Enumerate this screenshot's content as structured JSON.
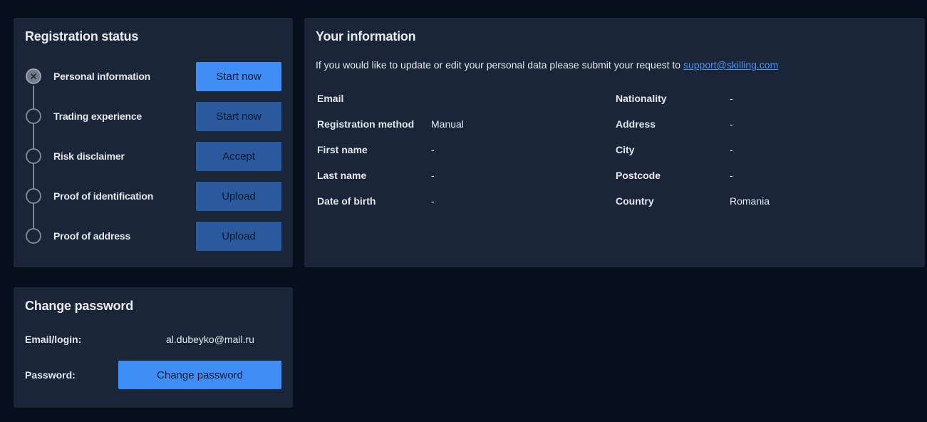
{
  "colors": {
    "page_bg": "#060f1c",
    "card_bg": "#1a2538",
    "primary_button": "#3f8ef5",
    "secondary_button": "#2a5a9d",
    "link": "#4a93f0"
  },
  "registration": {
    "title": "Registration status",
    "steps": [
      {
        "label": "Personal information",
        "button": "Start now",
        "icon": "close-icon",
        "status": "active"
      },
      {
        "label": "Trading experience",
        "button": "Start now"
      },
      {
        "label": "Risk disclaimer",
        "button": "Accept"
      },
      {
        "label": "Proof of identification",
        "button": "Upload"
      },
      {
        "label": "Proof of address",
        "button": "Upload"
      }
    ]
  },
  "password": {
    "title": "Change password",
    "email_label": "Email/login:",
    "email_value": "al.dubeyko@mail.ru",
    "password_label": "Password:",
    "button": "Change password"
  },
  "info": {
    "title": "Your information",
    "note": "If you would like to update or edit your personal data please submit your request to",
    "support_email": "support@skilling.com",
    "left": [
      {
        "label": "Email",
        "value": ""
      },
      {
        "label": "Registration method",
        "value": "Manual"
      },
      {
        "label": "First name",
        "value": "-"
      },
      {
        "label": "Last name",
        "value": "-"
      },
      {
        "label": "Date of birth",
        "value": "-"
      }
    ],
    "right": [
      {
        "label": "Nationality",
        "value": "-"
      },
      {
        "label": "Address",
        "value": "-"
      },
      {
        "label": "City",
        "value": "-"
      },
      {
        "label": "Postcode",
        "value": "-"
      },
      {
        "label": "Country",
        "value": "Romania"
      }
    ]
  }
}
